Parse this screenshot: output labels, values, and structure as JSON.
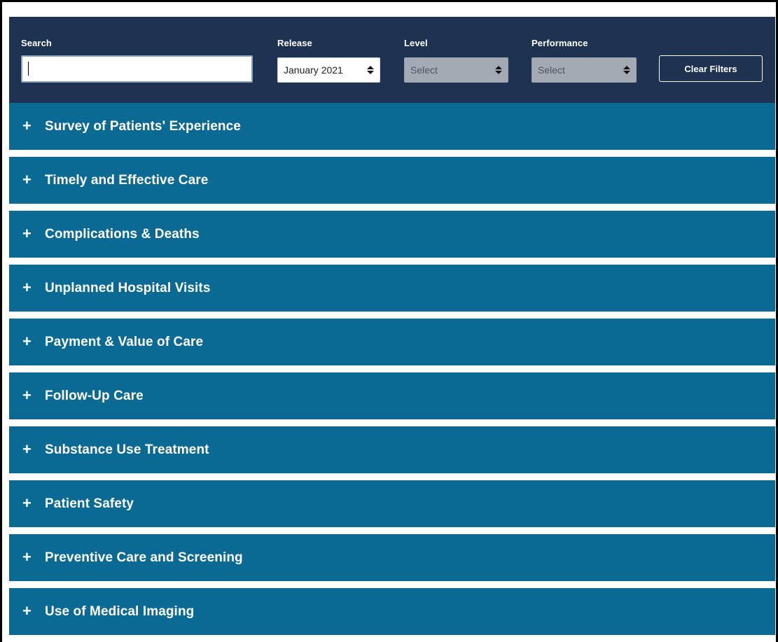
{
  "filters": {
    "search": {
      "label": "Search",
      "value": "",
      "placeholder": ""
    },
    "release": {
      "label": "Release",
      "value": "January 2021"
    },
    "level": {
      "label": "Level",
      "value": "Select"
    },
    "performance": {
      "label": "Performance",
      "value": "Select"
    },
    "clear_label": "Clear Filters"
  },
  "sections": [
    {
      "icon": "+",
      "title": "Survey of Patients' Experience"
    },
    {
      "icon": "+",
      "title": "Timely and Effective Care"
    },
    {
      "icon": "+",
      "title": "Complications & Deaths"
    },
    {
      "icon": "+",
      "title": "Unplanned Hospital Visits"
    },
    {
      "icon": "+",
      "title": "Payment & Value of Care"
    },
    {
      "icon": "+",
      "title": "Follow-Up Care"
    },
    {
      "icon": "+",
      "title": "Substance Use Treatment"
    },
    {
      "icon": "+",
      "title": "Patient Safety"
    },
    {
      "icon": "+",
      "title": "Preventive Care and Screening"
    },
    {
      "icon": "+",
      "title": "Use of Medical Imaging"
    }
  ],
  "colors": {
    "filter_bar": "#1e3252",
    "section_bg": "#0b6a94",
    "text": "#ffffff",
    "disabled_select": "#a3aab3"
  }
}
